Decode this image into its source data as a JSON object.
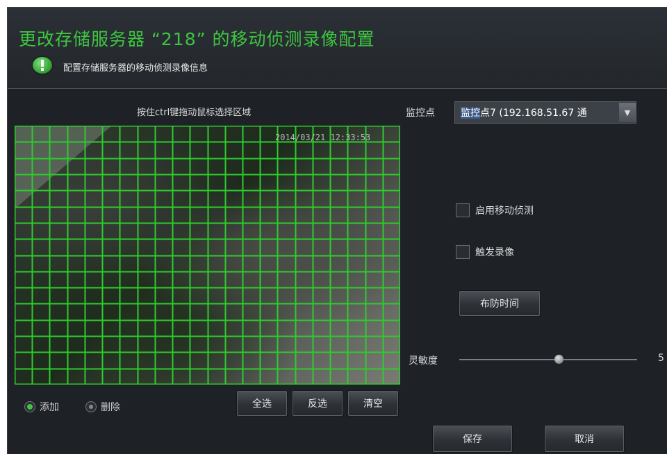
{
  "dialog": {
    "title": "更改存储服务器 “218” 的移动侦测录像配置",
    "subtitle": "配置存储服务器的移动侦测录像信息"
  },
  "region": {
    "hint": "按住ctrl键拖动鼠标选择区域",
    "timestamp": "2014/03/21 12:33:53",
    "grid_cols": 22,
    "grid_rows": 16,
    "grid_color": "#2ecc2e"
  },
  "mode": {
    "add_label": "添加",
    "delete_label": "删除",
    "selected": "添加"
  },
  "grid_buttons": {
    "select_all": "全选",
    "invert": "反选",
    "clear": "清空"
  },
  "monitor": {
    "label": "监控点",
    "selected_highlight": "监控",
    "selected_rest": "点7 (192.168.51.67 通"
  },
  "options": {
    "enable_motion_detection": "启用移动侦测",
    "trigger_recording": "触发录像",
    "enable_motion_detection_checked": false,
    "trigger_recording_checked": false
  },
  "schedule_button": "布防时间",
  "sensitivity": {
    "label": "灵敏度",
    "value": "5",
    "fraction": 0.56
  },
  "footer": {
    "save": "保存",
    "cancel": "取消"
  },
  "colors": {
    "accent": "#3ec640",
    "background": "#1e2227"
  }
}
